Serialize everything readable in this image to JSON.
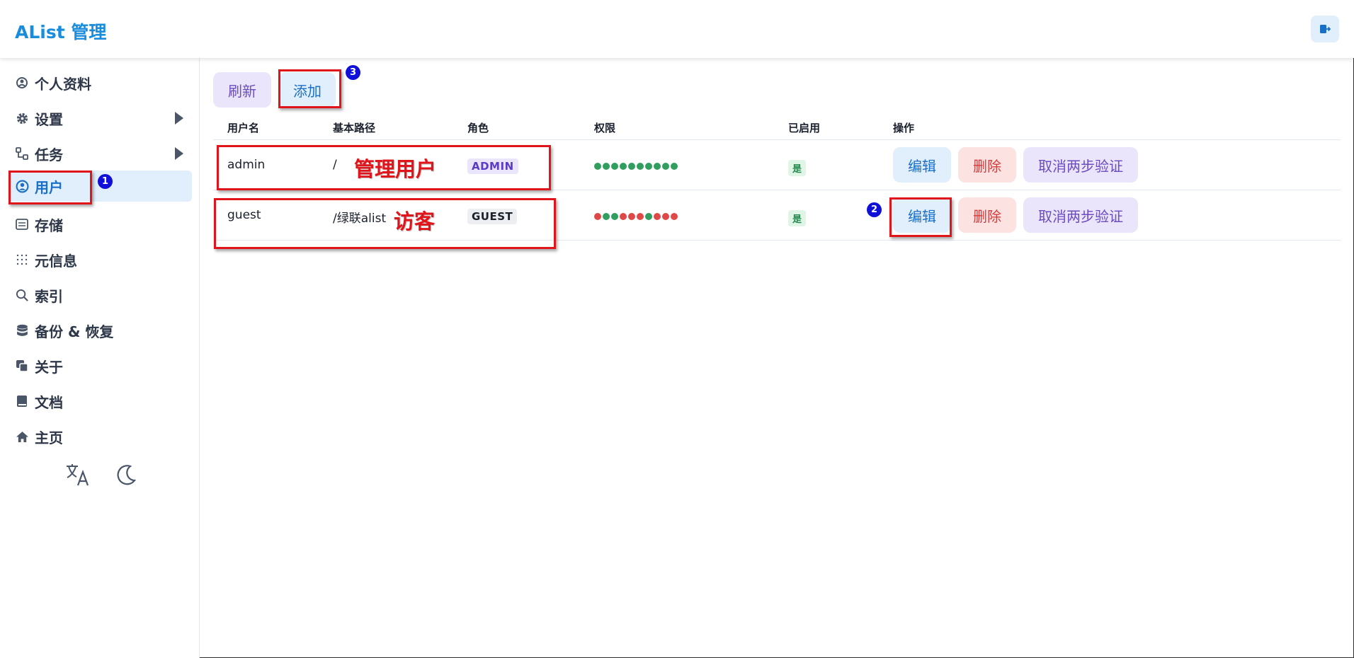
{
  "app": {
    "title": "AList 管理"
  },
  "header": {
    "logout_icon": "logout-icon"
  },
  "sidebar": {
    "items": [
      {
        "label": "个人资料",
        "icon": "profile-icon"
      },
      {
        "label": "设置",
        "icon": "gear-icon",
        "expandable": true
      },
      {
        "label": "任务",
        "icon": "tasks-icon",
        "expandable": true
      },
      {
        "label": "用户",
        "icon": "user-icon",
        "active": true
      },
      {
        "label": "存储",
        "icon": "storage-icon"
      },
      {
        "label": "元信息",
        "icon": "meta-icon"
      },
      {
        "label": "索引",
        "icon": "search-icon"
      },
      {
        "label": "备份 & 恢复",
        "icon": "database-icon"
      },
      {
        "label": "关于",
        "icon": "copy-icon"
      },
      {
        "label": "文档",
        "icon": "book-icon"
      },
      {
        "label": "主页",
        "icon": "home-icon"
      }
    ],
    "tools": {
      "translate_icon": "translate-icon",
      "theme_icon": "moon-icon"
    }
  },
  "toolbar": {
    "refresh_label": "刷新",
    "add_label": "添加"
  },
  "table": {
    "columns": [
      "用户名",
      "基本路径",
      "角色",
      "权限",
      "已启用",
      "操作"
    ],
    "rows": [
      {
        "username": "admin",
        "base_path": "/",
        "role": "ADMIN",
        "permissions": [
          "on",
          "on",
          "on",
          "on",
          "on",
          "on",
          "on",
          "on",
          "on",
          "on"
        ],
        "enabled": "是",
        "actions": {
          "edit": "编辑",
          "delete": "删除",
          "cancel_2fa": "取消两步验证"
        }
      },
      {
        "username": "guest",
        "base_path": "/绿联alist",
        "role": "GUEST",
        "permissions": [
          "off",
          "on",
          "on",
          "off",
          "off",
          "off",
          "on",
          "off",
          "off",
          "off"
        ],
        "enabled": "是",
        "actions": {
          "edit": "编辑",
          "delete": "删除",
          "cancel_2fa": "取消两步验证"
        }
      }
    ]
  },
  "annotations": {
    "admin_note": "管理用户",
    "guest_note": "访客",
    "markers": [
      "1",
      "2",
      "3"
    ]
  },
  "colors": {
    "brand": "#1a8cdc",
    "perm_on": "#2f9e5e",
    "perm_off": "#e04848",
    "annotation_red": "#e0141b",
    "marker_blue": "#1010d8"
  }
}
